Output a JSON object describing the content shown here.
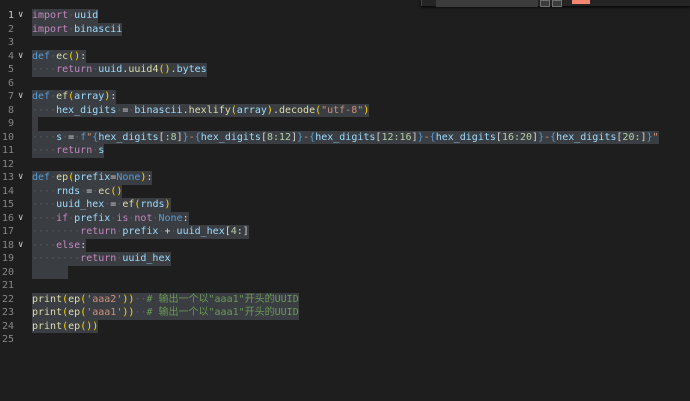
{
  "editor": {
    "active_line": 1,
    "lines": [
      {
        "n": "1",
        "fold": "v",
        "text": "import uuid"
      },
      {
        "n": "2",
        "fold": "",
        "text": "import binascii"
      },
      {
        "n": "3",
        "fold": "",
        "text": ""
      },
      {
        "n": "4",
        "fold": "v",
        "text": "def ec():"
      },
      {
        "n": "5",
        "fold": "",
        "text": "    return uuid.uuid4().bytes"
      },
      {
        "n": "6",
        "fold": "",
        "text": ""
      },
      {
        "n": "7",
        "fold": "v",
        "text": "def ef(array):"
      },
      {
        "n": "8",
        "fold": "",
        "text": "    hex_digits = binascii.hexlify(array).decode(\"utf-8\")"
      },
      {
        "n": "9",
        "fold": "",
        "text": ""
      },
      {
        "n": "10",
        "fold": "",
        "text": "    s = f\"{hex_digits[:8]}-{hex_digits[8:12]}-{hex_digits[12:16]}-{hex_digits[16:20]}-{hex_digits[20:]}\""
      },
      {
        "n": "11",
        "fold": "",
        "text": "    return s"
      },
      {
        "n": "12",
        "fold": "",
        "text": ""
      },
      {
        "n": "13",
        "fold": "v",
        "text": "def ep(prefix=None):"
      },
      {
        "n": "14",
        "fold": "",
        "text": "    rnds = ec()"
      },
      {
        "n": "15",
        "fold": "",
        "text": "    uuid_hex = ef(rnds)"
      },
      {
        "n": "16",
        "fold": "v",
        "text": "    if prefix is not None:"
      },
      {
        "n": "17",
        "fold": "",
        "text": "        return prefix + uuid_hex[4:]"
      },
      {
        "n": "18",
        "fold": "v",
        "text": "    else:"
      },
      {
        "n": "19",
        "fold": "",
        "text": "        return uuid_hex"
      },
      {
        "n": "20",
        "fold": "",
        "text": ""
      },
      {
        "n": "21",
        "fold": "",
        "text": ""
      },
      {
        "n": "22",
        "fold": "",
        "text": "print(ep('aaa2'))  # 输出一个以\"aaa1\"开头的UUID"
      },
      {
        "n": "23",
        "fold": "",
        "text": "print(ep('aaa1'))  # 输出一个以\"aaa1\"开头的UUID"
      },
      {
        "n": "24",
        "fold": "",
        "text": "print(ep())"
      },
      {
        "n": "25",
        "fold": "",
        "text": ""
      }
    ]
  },
  "colors": {
    "background": "#1e1e1e",
    "selection": "#3a3d41",
    "keyword": "#c586c0",
    "storage": "#569cd6",
    "function": "#dcdcaa",
    "variable": "#9cdcfe",
    "string": "#ce9178",
    "number": "#b5cea8",
    "comment": "#6a9955"
  },
  "icons": {
    "fold_open": "chevron-down-icon"
  }
}
